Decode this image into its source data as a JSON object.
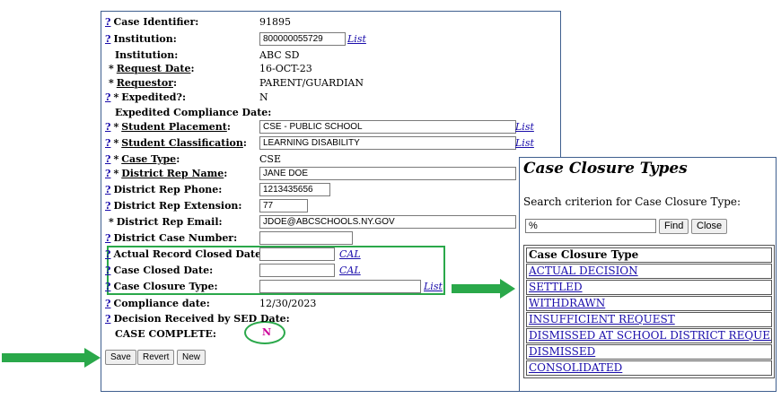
{
  "form": {
    "rows": [
      {
        "help": "?",
        "star": "",
        "label": "Case Identifier:",
        "underline": false,
        "value": "91895"
      },
      {
        "help": "?",
        "star": "",
        "label": "Institution:",
        "underline": false,
        "input": "800000055729",
        "link": "List"
      },
      {
        "help": "",
        "star": "",
        "label": "Institution:",
        "underline": false,
        "value": "ABC SD"
      },
      {
        "help": "",
        "star": "*",
        "label": "Request Date",
        "underline": true,
        "suffix": ":",
        "value": "16-OCT-23"
      },
      {
        "help": "",
        "star": "*",
        "label": "Requestor",
        "underline": true,
        "suffix": ":",
        "value": "PARENT/GUARDIAN"
      },
      {
        "help": "?",
        "star": "*",
        "label": "Expedited?:",
        "underline": false,
        "value": "N"
      },
      {
        "help": "",
        "star": "",
        "label": "Expedited Compliance Date:",
        "underline": false
      },
      {
        "help": "?",
        "star": "*",
        "label": "Student Placement",
        "underline": true,
        "suffix": ":",
        "input": "CSE - PUBLIC SCHOOL",
        "link": "List"
      },
      {
        "help": "?",
        "star": "*",
        "label": "Student Classification",
        "underline": true,
        "suffix": ":",
        "input": "LEARNING DISABILITY",
        "link": "List"
      },
      {
        "help": "?",
        "star": "*",
        "label": "Case Type",
        "underline": true,
        "suffix": ":",
        "value": "CSE"
      },
      {
        "help": "?",
        "star": "*",
        "label": "District Rep Name",
        "underline": true,
        "suffix": ":",
        "input": "JANE DOE"
      },
      {
        "help": "?",
        "star": "",
        "label": "District Rep Phone:",
        "underline": false,
        "input": "1213435656"
      },
      {
        "help": "?",
        "star": "",
        "label": "District Rep Extension:",
        "underline": false,
        "input": "77"
      },
      {
        "help": "",
        "star": "*",
        "label": "District Rep Email:",
        "underline": false,
        "input": "JDOE@ABCSCHOOLS.NY.GOV"
      },
      {
        "help": "?",
        "star": "",
        "label": "District Case Number:",
        "underline": false,
        "input": ""
      },
      {
        "help": "?",
        "star": "",
        "label": "Actual Record Closed Date:",
        "underline": false,
        "input": "",
        "link": "CAL"
      },
      {
        "help": "?",
        "star": "",
        "label": "Case Closed Date:",
        "underline": false,
        "input": "",
        "link": "CAL"
      },
      {
        "help": "?",
        "star": "",
        "label": "Case Closure Type:",
        "underline": false,
        "input": "",
        "link": "List"
      },
      {
        "help": "?",
        "star": "",
        "label": "Compliance date:",
        "underline": false,
        "value": "12/30/2023"
      },
      {
        "help": "?",
        "star": "",
        "label": "Decision Received by SED Date:",
        "underline": false
      },
      {
        "help": "",
        "star": "",
        "label": "CASE COMPLETE:",
        "underline": false
      }
    ],
    "case_complete_value": "N",
    "buttons": {
      "save": "Save",
      "revert": "Revert",
      "new": "New"
    }
  },
  "popup": {
    "title": "Case Closure Types",
    "criterion_label": "Search criterion for Case Closure Type:",
    "search_value": "%",
    "find_label": "Find",
    "close_label": "Close",
    "table_header": "Case Closure Type",
    "items": [
      "ACTUAL DECISION",
      "SETTLED",
      "WITHDRAWN",
      "INSUFFICIENT REQUEST",
      "DISMISSED AT SCHOOL DISTRICT REQUEST",
      "DISMISSED",
      "CONSOLIDATED"
    ]
  },
  "colors": {
    "accent_green": "#2aa84a",
    "link_blue": "#1a0dab",
    "magenta": "#cc0099",
    "panel_border": "#3f5f8f"
  }
}
